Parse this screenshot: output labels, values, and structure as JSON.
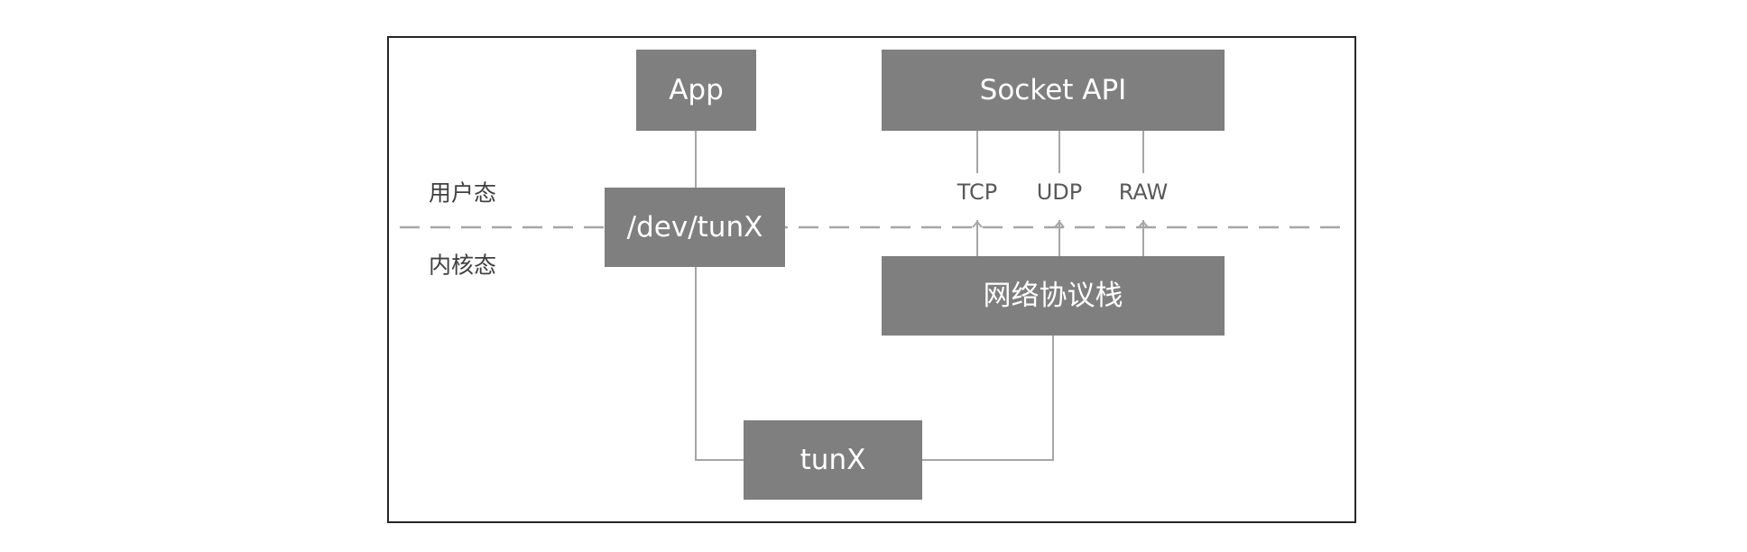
{
  "boxes": {
    "app": "App",
    "socket_api": "Socket API",
    "dev_tun": "/dev/tunX",
    "stack": "网络协议栈",
    "tun": "tunX"
  },
  "protocols": {
    "tcp": "TCP",
    "udp": "UDP",
    "raw": "RAW"
  },
  "zones": {
    "user": "用户态",
    "kernel": "内核态"
  },
  "colors": {
    "box_fill": "#7f7f7f",
    "box_text": "#ffffff",
    "connector": "#a6a6a6",
    "frame": "#262626"
  }
}
